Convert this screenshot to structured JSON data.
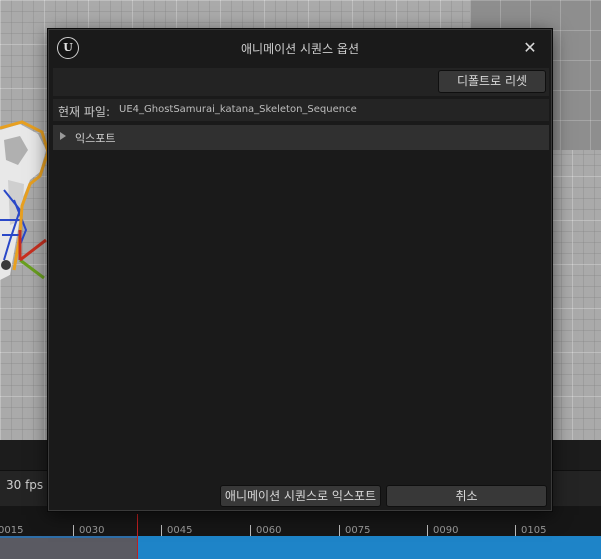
{
  "dialog": {
    "title": "애니메이션 시퀀스 옵션",
    "logo_glyph": "U",
    "close_glyph": "✕",
    "reset_button_label": "디폴트로 리셋",
    "current_file_label": "현재 파일:",
    "current_file_value": "UE4_GhostSamurai_katana_Skeleton_Sequence",
    "export_section_label": "익스포트",
    "export_button_label": "애니메이션 시퀀스로 익스포트",
    "cancel_button_label": "취소"
  },
  "timeline": {
    "fps_label": "30 fps",
    "ticks": [
      "0015",
      "0030",
      "0045",
      "0060",
      "0075",
      "0090",
      "0105"
    ]
  },
  "icons": {
    "logo": "unreal-logo-icon",
    "close": "close-icon",
    "expand": "chevron-right-icon"
  },
  "colors": {
    "dialog_background": "#1a1a1a",
    "button_background": "#383838",
    "track_blue": "#1e84c8",
    "playhead_red": "#c02020",
    "selection_orange": "#e8a020"
  }
}
